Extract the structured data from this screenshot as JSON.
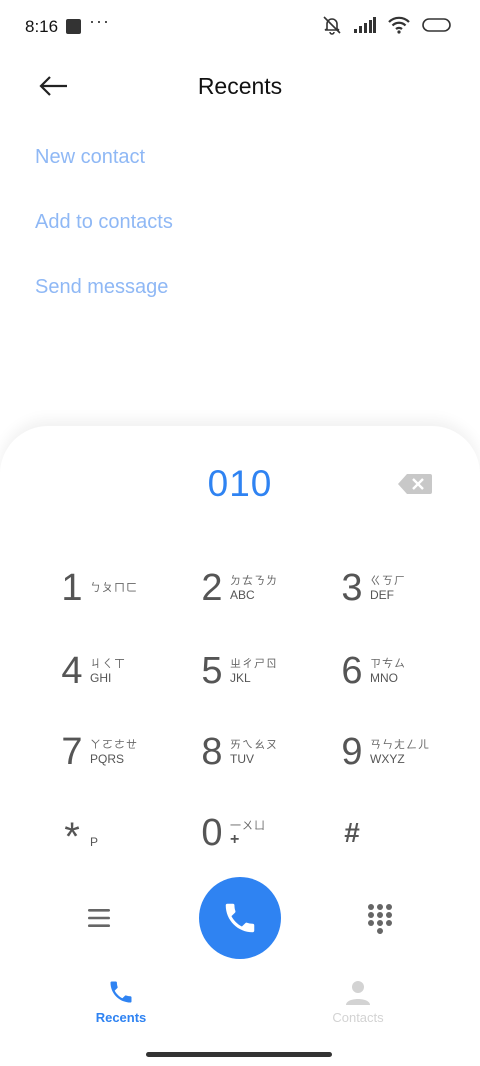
{
  "status_bar": {
    "time": "8:16",
    "dots": "···"
  },
  "header": {
    "title": "Recents"
  },
  "actions": [
    {
      "label": "New contact"
    },
    {
      "label": "Add to contacts"
    },
    {
      "label": "Send message"
    }
  ],
  "dialpad": {
    "number": "010",
    "keys": [
      {
        "digit": "1",
        "bopomofo": "ㄅㄆㄇㄈ",
        "letters": ""
      },
      {
        "digit": "2",
        "bopomofo": "ㄉㄊㄋㄌ",
        "letters": "ABC"
      },
      {
        "digit": "3",
        "bopomofo": "ㄍㄎㄏ",
        "letters": "DEF"
      },
      {
        "digit": "4",
        "bopomofo": "ㄐㄑㄒ",
        "letters": "GHI"
      },
      {
        "digit": "5",
        "bopomofo": "ㄓㄔㄕㄖ",
        "letters": "JKL"
      },
      {
        "digit": "6",
        "bopomofo": "ㄗㄘㄙ",
        "letters": "MNO"
      },
      {
        "digit": "7",
        "bopomofo": "ㄚㄛㄜㄝ",
        "letters": "PQRS"
      },
      {
        "digit": "8",
        "bopomofo": "ㄞㄟㄠㄡ",
        "letters": "TUV"
      },
      {
        "digit": "9",
        "bopomofo": "ㄢㄣㄤㄥㄦ",
        "letters": "WXYZ"
      },
      {
        "digit": "*",
        "bopomofo": "",
        "letters": "P"
      },
      {
        "digit": "0",
        "bopomofo": "一ㄨㄩ",
        "letters": "+"
      },
      {
        "digit": "#",
        "bopomofo": "",
        "letters": ""
      }
    ]
  },
  "bottom_nav": [
    {
      "label": "Recents",
      "active": true
    },
    {
      "label": "Contacts",
      "active": false
    }
  ],
  "colors": {
    "accent": "#2f83f2",
    "link": "#8fb8f5",
    "inactive": "#d3d3d3"
  }
}
